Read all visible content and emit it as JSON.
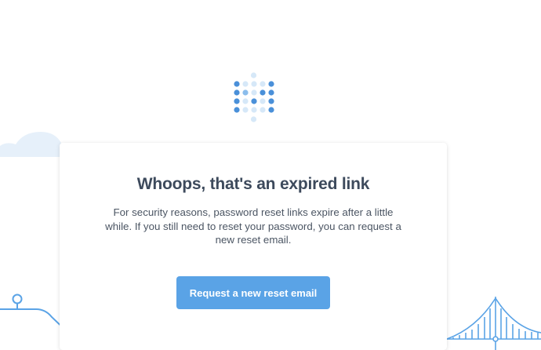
{
  "logo": {
    "icon": "dot-grid-logo-icon",
    "colors": {
      "dark": "#4a90d9",
      "mid": "#8bbdec",
      "light": "#d6e8f8"
    }
  },
  "card": {
    "title": "Whoops, that's an expired link",
    "message": "For security reasons, password reset links expire after a little while. If you still need to reset your password, you can request a new reset email.",
    "button_label": "Request a new reset email"
  },
  "colors": {
    "accent": "#5aa3e6",
    "title": "#3d4a5c",
    "text": "#4b5563",
    "illustration": "#5aa3e6",
    "cloud": "#e6f0fa"
  },
  "illustration": {
    "left": "cloud-and-track-icon",
    "right": "suspension-bridge-icon"
  }
}
